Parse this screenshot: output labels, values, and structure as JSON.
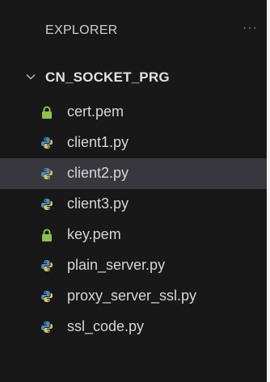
{
  "explorer": {
    "title": "EXPLORER",
    "more_actions": "···"
  },
  "folder": {
    "name": "CN_SOCKET_PRG",
    "expanded": true
  },
  "files": [
    {
      "name": "cert.pem",
      "icon": "lock-icon"
    },
    {
      "name": "client1.py",
      "icon": "python-icon"
    },
    {
      "name": "client2.py",
      "icon": "python-icon",
      "selected": true
    },
    {
      "name": "client3.py",
      "icon": "python-icon"
    },
    {
      "name": "key.pem",
      "icon": "lock-icon"
    },
    {
      "name": "plain_server.py",
      "icon": "python-icon"
    },
    {
      "name": "proxy_server_ssl.py",
      "icon": "python-icon"
    },
    {
      "name": "ssl_code.py",
      "icon": "python-icon"
    }
  ],
  "colors": {
    "background": "#181818",
    "selected_row": "#37373d",
    "lock": "#8bc34a",
    "python_blue": "#4b8bbe",
    "python_yellow": "#d6c46a"
  }
}
